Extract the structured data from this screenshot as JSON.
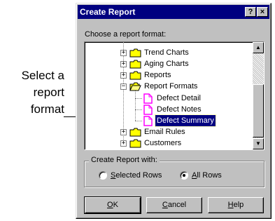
{
  "callout": {
    "lines": [
      "Select a",
      "report",
      "format"
    ]
  },
  "dialog": {
    "title": "Create Report",
    "help_glyph": "?",
    "close_glyph": "×",
    "prompt": "Choose a report format:",
    "tree": {
      "items": [
        {
          "label": "Trend Charts",
          "expander": "+",
          "icon": "folder-icon"
        },
        {
          "label": "Aging Charts",
          "expander": "+",
          "icon": "folder-icon"
        },
        {
          "label": "Reports",
          "expander": "+",
          "icon": "folder-icon"
        },
        {
          "label": "Report Formats",
          "expander": "−",
          "icon": "open-folder-icon"
        },
        {
          "label": "Defect Detail",
          "icon": "document-icon"
        },
        {
          "label": "Defect Notes",
          "icon": "document-icon"
        },
        {
          "label": "Defect Summary",
          "icon": "document-icon",
          "selected": true
        },
        {
          "label": "Email Rules",
          "expander": "+",
          "icon": "folder-icon"
        },
        {
          "label": "Customers",
          "expander": "+",
          "icon": "folder-icon"
        }
      ],
      "scroll_up": "▲",
      "scroll_down": "▼"
    },
    "group": {
      "label": "Create Report with:",
      "options": [
        {
          "label_key": "S",
          "label_rest": "elected Rows",
          "checked": false
        },
        {
          "label_key": "A",
          "label_rest": "ll Rows",
          "checked": true
        }
      ]
    },
    "buttons": [
      {
        "key": "O",
        "rest": "K"
      },
      {
        "key": "C",
        "rest": "ancel"
      },
      {
        "key": "H",
        "rest": "elp"
      }
    ]
  },
  "colors": {
    "titlebar": "#000080",
    "selection": "#000080",
    "face": "#c0c0c0",
    "folder": "#ffff00",
    "document": "#ff00ff"
  }
}
